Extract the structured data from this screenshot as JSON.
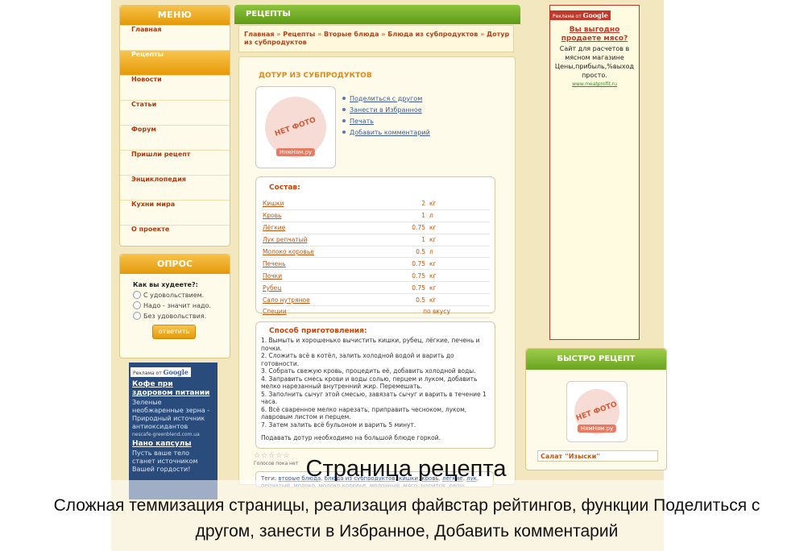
{
  "menu": {
    "title": "МЕНЮ",
    "items": [
      "Главная",
      "Рецепты",
      "Новости",
      "Статьи",
      "Форум",
      "Пришли рецепт",
      "Энциклопедия",
      "Кухни мира",
      "О проекте"
    ],
    "active_index": 1
  },
  "poll": {
    "title": "ОПРОС",
    "question": "Как вы худеете?:",
    "options": [
      "С удовольствием.",
      "Надо - значит надо.",
      "Без удовольствия."
    ],
    "button": "ответить"
  },
  "ad_left": {
    "badge_prefix": "Реклама от",
    "badge_brand": "Google",
    "ads": [
      {
        "title": "Кофе при здоровом питании",
        "text": "Зеленые необжаренные зерна - Природный источник антиоксидантов",
        "url": "nescafe-greenblend.com.ua"
      },
      {
        "title": "Нано капсулы",
        "text": "Пусть ваше тело станет источником Вашей гордости!",
        "url": ""
      }
    ]
  },
  "recipes_header": "РЕЦЕПТЫ",
  "breadcrumb": [
    "Главная",
    "Рецепты",
    "Вторые блюда",
    "Блюда из субпродуктов",
    "Дотур из субпродуктов"
  ],
  "recipe": {
    "title": "ДОТУР ИЗ СУБПРОДУКТОВ",
    "photo_label": "НЕТ ФОТО",
    "photo_brand": "НямНям.ру",
    "actions": [
      "Поделиться с другом",
      "Занести в Избранное",
      "Печать",
      "Добавить комментарий"
    ],
    "ingredients_title": "Состав:",
    "ingredients": [
      {
        "name": "Кишки",
        "qty": "2",
        "unit": "кг"
      },
      {
        "name": "Кровь",
        "qty": "1",
        "unit": "л"
      },
      {
        "name": "Лёгкие",
        "qty": "0.75",
        "unit": "кг"
      },
      {
        "name": "Лук репчатый",
        "qty": "1",
        "unit": "кг"
      },
      {
        "name": "Молоко коровье",
        "qty": "0.5",
        "unit": "л"
      },
      {
        "name": "Печень",
        "qty": "0.75",
        "unit": "кг"
      },
      {
        "name": "Почки",
        "qty": "0.75",
        "unit": "кг"
      },
      {
        "name": "Рубец",
        "qty": "0.75",
        "unit": "кг"
      },
      {
        "name": "Сало нутряное",
        "qty": "0.5",
        "unit": "кг"
      },
      {
        "name": "Специи",
        "qty": "",
        "unit": "",
        "note": "по вкусу"
      }
    ],
    "method_title": "Способ приготовления:",
    "steps": [
      "1. Вымыть и хорошенько вычистить кишки, рубец, лёгкие, печень и почки.",
      "2. Сложить всё в котёл, залить холодной водой и варить до готовности.",
      "3. Собрать свежую кровь, процедить её, добавить холодной воды.",
      "4. Заправить смесь крови и воды солью, перцем и луком, добавить мелко нарезанный внутренний жир. Перемешать.",
      "5. Заполнить сычуг этой смесью, завязать сычуг и варить в течение 1 часа.",
      "6. Всё сваренное мелко нарезать, приправить чесноком, луком, лавровым листом и перцем.",
      "7. Затем залить всё бульоном и варить 5 минут."
    ],
    "serve": "Подавать дотур необходимо на большой блюде горкой.",
    "rating": 0,
    "votes_text": "Голосов пока нет",
    "tags_label": "Теги:",
    "tags": [
      "вторые блюда",
      "блюда из субпродуктов",
      "кишки",
      "кровь",
      "лёгкие",
      "лук",
      "репчатый",
      "молоко",
      "молоко коровье",
      "молочный",
      "мясо",
      "напиток",
      "овощ",
      "печень",
      "почки",
      "растение",
      "рубец",
      "сало",
      "сало нутряное",
      "специи"
    ]
  },
  "ad_right": {
    "badge_prefix": "Реклама от",
    "badge_brand": "Google",
    "title": "Вы выгодно продаете мясо?",
    "text": "Сайт для расчетов в мясном магазине Цены,прибыль,%выход просто.",
    "url": "www.meatprofit.ru"
  },
  "quick": {
    "title": "БЫСТРО РЕЦЕПТ",
    "photo_label": "НЕТ ФОТО",
    "photo_brand": "НямНям.ру",
    "caption": "Салат ''Изыски''"
  },
  "overlay": {
    "title": "Страница  рецепта",
    "subtitle": "Сложная теммизация страницы, реализация файвстар рейтингов, функции Поделиться с другом, занести в Избранное, Добавить комментарий"
  },
  "colors": {
    "menu_accent": "#e49a08",
    "recipe_accent": "#5e9a16",
    "link": "#3b5b9a",
    "ingredient": "#c35610"
  }
}
